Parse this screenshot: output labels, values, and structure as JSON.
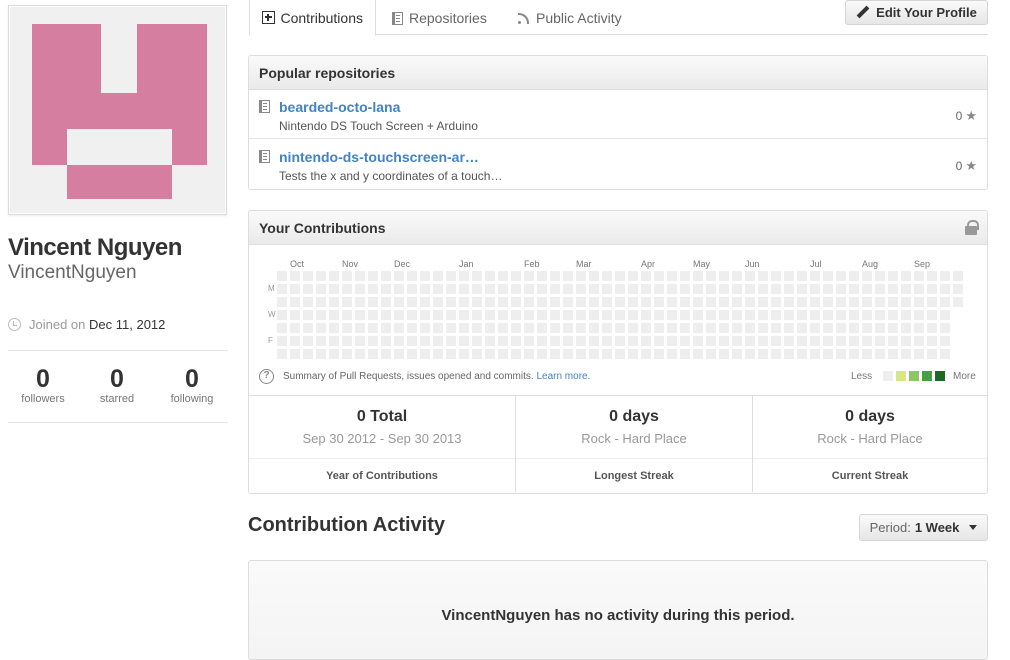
{
  "profile": {
    "fullname": "Vincent Nguyen",
    "username": "VincentNguyen",
    "joined_prefix": "Joined on",
    "joined_date": "Dec 11, 2012",
    "avatar_color": "#d67ea0",
    "stats": [
      {
        "num": "0",
        "label": "followers"
      },
      {
        "num": "0",
        "label": "starred"
      },
      {
        "num": "0",
        "label": "following"
      }
    ]
  },
  "tabs": [
    {
      "label": "Contributions",
      "icon": "plus-square-icon",
      "active": true
    },
    {
      "label": "Repositories",
      "icon": "repo-icon",
      "active": false
    },
    {
      "label": "Public Activity",
      "icon": "rss-icon",
      "active": false
    }
  ],
  "edit_profile_label": "Edit Your Profile",
  "popular": {
    "title": "Popular repositories",
    "repos": [
      {
        "name": "bearded-octo-lana",
        "desc": "Nintendo DS Touch Screen + Arduino",
        "stars": "0"
      },
      {
        "name": "nintendo-ds-touchscreen-ar…",
        "desc": "Tests the x and y coordinates of a touch…",
        "stars": "0"
      }
    ]
  },
  "contrib": {
    "title": "Your Contributions",
    "months": [
      "Oct",
      "Nov",
      "Dec",
      "Jan",
      "Feb",
      "Mar",
      "Apr",
      "May",
      "Jun",
      "Jul",
      "Aug",
      "Sep"
    ],
    "day_labels": [
      "M",
      "W",
      "F"
    ],
    "summary": "Summary of Pull Requests, issues opened and commits.",
    "learn_more": "Learn more.",
    "less": "Less",
    "more": "More",
    "legend_colors": [
      "#eeeeee",
      "#d6e685",
      "#8cc665",
      "#44a340",
      "#1e6823"
    ],
    "stats": [
      {
        "big": "0 Total",
        "sub": "Sep 30 2012 - Sep 30 2013",
        "cap": "Year of Contributions"
      },
      {
        "big": "0 days",
        "sub": "Rock - Hard Place",
        "cap": "Longest Streak"
      },
      {
        "big": "0 days",
        "sub": "Rock - Hard Place",
        "cap": "Current Streak"
      }
    ]
  },
  "activity": {
    "title": "Contribution Activity",
    "period_prefix": "Period:",
    "period_value": "1 Week",
    "empty_message": "VincentNguyen has no activity during this period."
  }
}
